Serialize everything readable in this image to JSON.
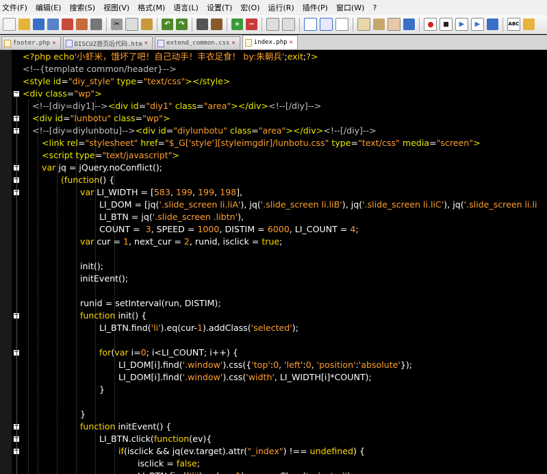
{
  "menu": {
    "items": [
      "文件(F)",
      "编辑(E)",
      "搜索(S)",
      "视图(V)",
      "格式(M)",
      "语言(L)",
      "设置(T)",
      "宏(O)",
      "运行(R)",
      "插件(P)",
      "窗口(W)",
      "?"
    ]
  },
  "tabs": [
    {
      "label": "footer.php",
      "active": false
    },
    {
      "label": "DISCUZ首页后代码.htm",
      "active": false
    },
    {
      "label": "extend_common.css",
      "active": false
    },
    {
      "label": "index.php",
      "active": true
    }
  ],
  "code_lines": [
    {
      "indent": 0,
      "tokens": [
        [
          "php",
          "<?php "
        ],
        [
          "kw",
          "echo"
        ],
        [
          "str",
          "'小虾米，饿坏了吧！自己动手！丰衣足食！ by:朱朝兵'"
        ],
        [
          "ident",
          ";"
        ],
        [
          "kw",
          "exit"
        ],
        [
          "ident",
          ";"
        ],
        [
          "php",
          "?>"
        ]
      ]
    },
    {
      "indent": 0,
      "tokens": [
        [
          "cmt",
          "<!--{template common/header}-->"
        ]
      ]
    },
    {
      "indent": 0,
      "tokens": [
        [
          "tag",
          "<style "
        ],
        [
          "attr",
          "id"
        ],
        [
          "ident",
          "="
        ],
        [
          "str",
          "\"diy_style\""
        ],
        [
          "attr",
          " type"
        ],
        [
          "ident",
          "="
        ],
        [
          "str",
          "\"text/css\""
        ],
        [
          "tag",
          "></style>"
        ]
      ]
    },
    {
      "indent": 0,
      "tokens": [
        [
          "tag",
          "<div "
        ],
        [
          "attr",
          "class"
        ],
        [
          "ident",
          "="
        ],
        [
          "str",
          "\"wp\""
        ],
        [
          "tag",
          ">"
        ]
      ]
    },
    {
      "indent": 1,
      "tokens": [
        [
          "cmt",
          "<!--[diy=diy1]-->"
        ],
        [
          "tag",
          "<div "
        ],
        [
          "attr",
          "id"
        ],
        [
          "ident",
          "="
        ],
        [
          "str",
          "\"diy1\""
        ],
        [
          "attr",
          " class"
        ],
        [
          "ident",
          "="
        ],
        [
          "str",
          "\"area\""
        ],
        [
          "tag",
          "></div>"
        ],
        [
          "cmt",
          "<!--[/diy]-->"
        ]
      ]
    },
    {
      "indent": 1,
      "tokens": [
        [
          "tag",
          "<div "
        ],
        [
          "attr",
          "id"
        ],
        [
          "ident",
          "="
        ],
        [
          "str",
          "\"lunbotu\""
        ],
        [
          "attr",
          " class"
        ],
        [
          "ident",
          "="
        ],
        [
          "str",
          "\"wp\""
        ],
        [
          "tag",
          ">"
        ]
      ]
    },
    {
      "indent": 1,
      "tokens": [
        [
          "cmt",
          "<!--[diy=diylunbotu]-->"
        ],
        [
          "tag",
          "<div "
        ],
        [
          "attr",
          "id"
        ],
        [
          "ident",
          "="
        ],
        [
          "str",
          "\"diylunbotu\""
        ],
        [
          "attr",
          " class"
        ],
        [
          "ident",
          "="
        ],
        [
          "str",
          "\"area\""
        ],
        [
          "tag",
          "></div>"
        ],
        [
          "cmt",
          "<!--[/diy]-->"
        ]
      ]
    },
    {
      "indent": 2,
      "tokens": [
        [
          "tag",
          "<link "
        ],
        [
          "attr",
          "rel"
        ],
        [
          "ident",
          "="
        ],
        [
          "str",
          "\"stylesheet\""
        ],
        [
          "attr",
          " href"
        ],
        [
          "ident",
          "="
        ],
        [
          "str",
          "\"$_G['style'][styleimgdir]/lunbotu.css\""
        ],
        [
          "attr",
          " type"
        ],
        [
          "ident",
          "="
        ],
        [
          "str",
          "\"text/css\""
        ],
        [
          "attr",
          " media"
        ],
        [
          "ident",
          "="
        ],
        [
          "str",
          "\"screen\""
        ],
        [
          "tag",
          ">"
        ]
      ]
    },
    {
      "indent": 2,
      "tokens": [
        [
          "tag",
          "<script "
        ],
        [
          "attr",
          "type"
        ],
        [
          "ident",
          "="
        ],
        [
          "str",
          "\"text/javascript\""
        ],
        [
          "tag",
          ">"
        ]
      ]
    },
    {
      "indent": 2,
      "tokens": [
        [
          "kw",
          "var "
        ],
        [
          "ident",
          "jq = jQuery.noConflict();"
        ]
      ]
    },
    {
      "indent": 4,
      "tokens": [
        [
          "kw",
          "(function"
        ],
        [
          "ident",
          "() {"
        ]
      ]
    },
    {
      "indent": 6,
      "tokens": [
        [
          "kw",
          "var "
        ],
        [
          "ident",
          "LI_WIDTH = ["
        ],
        [
          "num",
          "583"
        ],
        [
          "ident",
          ", "
        ],
        [
          "num",
          "199"
        ],
        [
          "ident",
          ", "
        ],
        [
          "num",
          "199"
        ],
        [
          "ident",
          ", "
        ],
        [
          "num",
          "198"
        ],
        [
          "ident",
          "],"
        ]
      ]
    },
    {
      "indent": 8,
      "tokens": [
        [
          "ident",
          "LI_DOM = [jq("
        ],
        [
          "str",
          "'.slide_screen li.liA'"
        ],
        [
          "ident",
          "), jq("
        ],
        [
          "str",
          "'.slide_screen li.liB'"
        ],
        [
          "ident",
          "), jq("
        ],
        [
          "str",
          "'.slide_screen li.liC'"
        ],
        [
          "ident",
          "), jq("
        ],
        [
          "str",
          "'.slide_screen li.li"
        ]
      ]
    },
    {
      "indent": 8,
      "tokens": [
        [
          "ident",
          "LI_BTN = jq("
        ],
        [
          "str",
          "'.slide_screen .libtn'"
        ],
        [
          "ident",
          "),"
        ]
      ]
    },
    {
      "indent": 8,
      "tokens": [
        [
          "ident",
          "COUNT =  "
        ],
        [
          "num",
          "3"
        ],
        [
          "ident",
          ", SPEED = "
        ],
        [
          "num",
          "1000"
        ],
        [
          "ident",
          ", DISTIM = "
        ],
        [
          "num",
          "6000"
        ],
        [
          "ident",
          ", LI_COUNT = "
        ],
        [
          "num",
          "4"
        ],
        [
          "ident",
          ";"
        ]
      ]
    },
    {
      "indent": 6,
      "tokens": [
        [
          "kw",
          "var "
        ],
        [
          "ident",
          "cur = "
        ],
        [
          "num",
          "1"
        ],
        [
          "ident",
          ", next_cur = "
        ],
        [
          "num",
          "2"
        ],
        [
          "ident",
          ", runid, isclick = "
        ],
        [
          "kw",
          "true"
        ],
        [
          "ident",
          ";"
        ]
      ]
    },
    {
      "indent": 6,
      "tokens": []
    },
    {
      "indent": 6,
      "tokens": [
        [
          "ident",
          "init();"
        ]
      ]
    },
    {
      "indent": 6,
      "tokens": [
        [
          "ident",
          "initEvent();"
        ]
      ]
    },
    {
      "indent": 6,
      "tokens": []
    },
    {
      "indent": 6,
      "tokens": [
        [
          "ident",
          "runid = setInterval(run, DISTIM);"
        ]
      ]
    },
    {
      "indent": 6,
      "tokens": [
        [
          "kw",
          "function "
        ],
        [
          "ident",
          "init() {"
        ]
      ]
    },
    {
      "indent": 8,
      "tokens": [
        [
          "ident",
          "LI_BTN.find("
        ],
        [
          "str",
          "'li'"
        ],
        [
          "ident",
          ").eq(cur-"
        ],
        [
          "num",
          "1"
        ],
        [
          "ident",
          ").addClass("
        ],
        [
          "str",
          "'selected'"
        ],
        [
          "ident",
          ");"
        ]
      ]
    },
    {
      "indent": 8,
      "tokens": []
    },
    {
      "indent": 8,
      "tokens": [
        [
          "kw",
          "for"
        ],
        [
          "ident",
          "("
        ],
        [
          "kw",
          "var "
        ],
        [
          "ident",
          "i="
        ],
        [
          "num",
          "0"
        ],
        [
          "ident",
          "; i<LI_COUNT; i++) {"
        ]
      ]
    },
    {
      "indent": 10,
      "tokens": [
        [
          "ident",
          "LI_DOM[i].find("
        ],
        [
          "str",
          "'.window'"
        ],
        [
          "ident",
          ").css({"
        ],
        [
          "str",
          "'top'"
        ],
        [
          "ident",
          ":"
        ],
        [
          "num",
          "0"
        ],
        [
          "ident",
          ", "
        ],
        [
          "str",
          "'left'"
        ],
        [
          "ident",
          ":"
        ],
        [
          "num",
          "0"
        ],
        [
          "ident",
          ", "
        ],
        [
          "str",
          "'position'"
        ],
        [
          "ident",
          ":"
        ],
        [
          "str",
          "'absolute'"
        ],
        [
          "ident",
          "});"
        ]
      ]
    },
    {
      "indent": 10,
      "tokens": [
        [
          "ident",
          "LI_DOM[i].find("
        ],
        [
          "str",
          "'.window'"
        ],
        [
          "ident",
          ").css("
        ],
        [
          "str",
          "'width'"
        ],
        [
          "ident",
          ", LI_WIDTH[i]*COUNT);"
        ]
      ]
    },
    {
      "indent": 8,
      "tokens": [
        [
          "ident",
          "}"
        ]
      ]
    },
    {
      "indent": 8,
      "tokens": []
    },
    {
      "indent": 6,
      "tokens": [
        [
          "ident",
          "}"
        ]
      ]
    },
    {
      "indent": 6,
      "tokens": [
        [
          "kw",
          "function "
        ],
        [
          "ident",
          "initEvent() {"
        ]
      ]
    },
    {
      "indent": 8,
      "tokens": [
        [
          "ident",
          "LI_BTN.click("
        ],
        [
          "kw",
          "function"
        ],
        [
          "ident",
          "(ev){"
        ]
      ]
    },
    {
      "indent": 10,
      "tokens": [
        [
          "kw",
          "if"
        ],
        [
          "ident",
          "(isclick && jq(ev.target).attr("
        ],
        [
          "str",
          "\"_index\""
        ],
        [
          "ident",
          ") !== "
        ],
        [
          "kw",
          "undefined"
        ],
        [
          "ident",
          ") {"
        ]
      ]
    },
    {
      "indent": 12,
      "tokens": [
        [
          "ident",
          "isclick = "
        ],
        [
          "kw",
          "false"
        ],
        [
          "ident",
          ";"
        ]
      ]
    },
    {
      "indent": 12,
      "tokens": [
        [
          "ident",
          "LI_BTN.find("
        ],
        [
          "str",
          "'li'"
        ],
        [
          "ident",
          ").eq(cur-"
        ],
        [
          "num",
          "1"
        ],
        [
          "ident",
          ").removeClass("
        ],
        [
          "str",
          "'selected'"
        ],
        [
          "ident",
          ");"
        ]
      ]
    }
  ]
}
